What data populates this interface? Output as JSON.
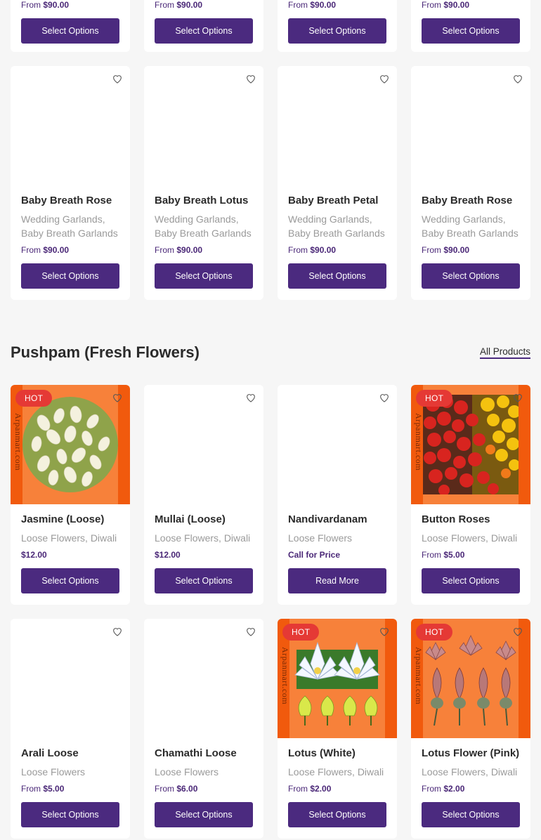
{
  "colors": {
    "accent": "#4b2a7f",
    "hot": "#e53935",
    "card_bg": "#ffffff"
  },
  "top_row": [
    {
      "price_prefix": "From",
      "price": "$90.00",
      "button": "Select Options"
    },
    {
      "price_prefix": "From",
      "price": "$90.00",
      "button": "Select Options"
    },
    {
      "price_prefix": "From",
      "price": "$90.00",
      "button": "Select Options"
    },
    {
      "price_prefix": "From",
      "price": "$90.00",
      "button": "Select Options"
    }
  ],
  "garlands": [
    {
      "title": "Baby Breath Rose",
      "categories": "Wedding Garlands, Baby Breath Garlands",
      "price_prefix": "From",
      "price": "$90.00",
      "button": "Select Options"
    },
    {
      "title": "Baby Breath Lotus",
      "categories": "Wedding Garlands, Baby Breath Garlands",
      "price_prefix": "From",
      "price": "$90.00",
      "button": "Select Options"
    },
    {
      "title": "Baby Breath Petal",
      "categories": "Wedding Garlands, Baby Breath Garlands",
      "price_prefix": "From",
      "price": "$90.00",
      "button": "Select Options"
    },
    {
      "title": "Baby Breath Rose",
      "categories": "Wedding Garlands, Baby Breath Garlands",
      "price_prefix": "From",
      "price": "$90.00",
      "button": "Select Options"
    }
  ],
  "section": {
    "title": "Pushpam (Fresh Flowers)",
    "link": "All Products"
  },
  "flowers_row1": [
    {
      "title": "Jasmine (Loose)",
      "categories": "Loose Flowers, Diwali",
      "price_prefix": "",
      "price": "$12.00",
      "button": "Select Options",
      "badge": "HOT",
      "watermark": "Arpanmart.com"
    },
    {
      "title": "Mullai (Loose)",
      "categories": "Loose Flowers, Diwali",
      "price_prefix": "",
      "price": "$12.00",
      "button": "Select Options"
    },
    {
      "title": "Nandivardanam",
      "categories": "Loose Flowers",
      "price_prefix": "",
      "price": "Call for Price",
      "button": "Read More"
    },
    {
      "title": "Button Roses",
      "categories": "Loose Flowers, Diwali",
      "price_prefix": "From",
      "price": "$5.00",
      "button": "Select Options",
      "badge": "HOT",
      "watermark": "Arpanmart.com"
    }
  ],
  "flowers_row2": [
    {
      "title": "Arali Loose",
      "categories": "Loose Flowers",
      "price_prefix": "From",
      "price": "$5.00",
      "button": "Select Options"
    },
    {
      "title": "Chamathi Loose",
      "categories": "Loose Flowers",
      "price_prefix": "From",
      "price": "$6.00",
      "button": "Select Options"
    },
    {
      "title": "Lotus (White)",
      "categories": "Loose Flowers, Diwali",
      "price_prefix": "From",
      "price": "$2.00",
      "button": "Select Options",
      "badge": "HOT",
      "watermark": "Arpanmart.com"
    },
    {
      "title": "Lotus Flower (Pink)",
      "categories": "Loose Flowers, Diwali",
      "price_prefix": "From",
      "price": "$2.00",
      "button": "Select Options",
      "badge": "HOT",
      "watermark": "Arpanmart.com"
    }
  ],
  "icons": {
    "wishlist": "heart-outline-icon"
  }
}
